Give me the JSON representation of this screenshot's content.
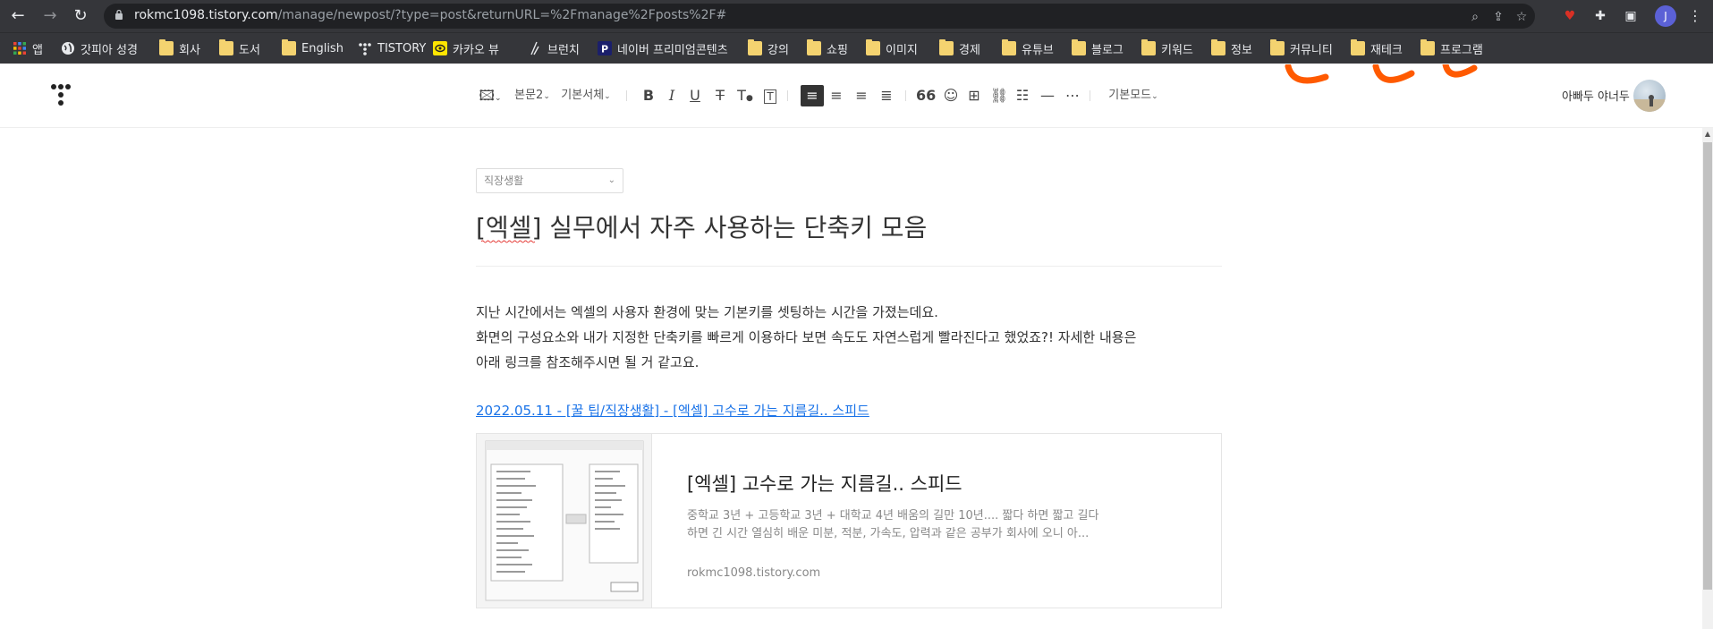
{
  "browser": {
    "url_host": "rokmc1098.tistory.com",
    "url_path": "/manage/newpost/?type=post&returnURL=%2Fmanage%2Fposts%2F#",
    "profile_initial": "J"
  },
  "bookmarks": [
    {
      "label": "앱",
      "icon": "apps-grid-icon"
    },
    {
      "label": "갓피아 성경",
      "icon": "globe-icon"
    },
    {
      "label": "회사",
      "icon": "folder-icon"
    },
    {
      "label": "도서",
      "icon": "folder-icon"
    },
    {
      "label": "English",
      "icon": "folder-icon"
    },
    {
      "label": "TISTORY",
      "icon": "tistory-icon"
    },
    {
      "label": "카카오 뷰",
      "icon": "kakao-view-icon"
    },
    {
      "label": "브런치",
      "icon": "brunch-icon"
    },
    {
      "label": "네이버 프리미엄콘텐츠",
      "icon": "naver-premium-icon"
    },
    {
      "label": "강의",
      "icon": "folder-icon"
    },
    {
      "label": "쇼핑",
      "icon": "folder-icon"
    },
    {
      "label": "이미지",
      "icon": "folder-icon"
    },
    {
      "label": "경제",
      "icon": "folder-icon"
    },
    {
      "label": "유튜브",
      "icon": "folder-icon"
    },
    {
      "label": "블로그",
      "icon": "folder-icon"
    },
    {
      "label": "키워드",
      "icon": "folder-icon"
    },
    {
      "label": "정보",
      "icon": "folder-icon"
    },
    {
      "label": "커뮤니티",
      "icon": "folder-icon"
    },
    {
      "label": "재테크",
      "icon": "folder-icon"
    },
    {
      "label": "프로그램",
      "icon": "folder-icon"
    }
  ],
  "toolbar": {
    "paragraph_style": "본문2",
    "font": "기본서체",
    "mode": "기본모드"
  },
  "user": {
    "name": "아빠두 야너두"
  },
  "post": {
    "category": "직장생활",
    "title": "[엑셀] 실무에서 자주 사용하는 단축키 모음",
    "para1": " 지난 시간에서는 엑셀의 사용자 환경에 맞는 기본키를 셋팅하는 시간을 가졌는데요.",
    "para2": "화면의 구성요소와 내가 지정한 단축키를 빠르게 이용하다 보면 속도도 자연스럽게 빨라진다고 했었죠?! 자세한 내용은",
    "para3": "아래 링크를 참조해주시면 될 거 같고요.",
    "link": "2022.05.11 - [꿀 팁/직장생활] - [엑셀] 고수로 가는 지름길.. 스피드"
  },
  "og_card": {
    "title": "[엑셀] 고수로 가는 지름길.. 스피드",
    "desc1": " 중학교 3년 + 고등학교 3년 + 대학교 4년 배움의 길만 10년.... 짧다 하면 짧고 길다",
    "desc2": "하면 긴 시간 열심히 배운 미분, 적분, 가속도, 압력과 같은 공부가 회사에 오니 아...",
    "url": "rokmc1098.tistory.com"
  },
  "colors": {
    "chrome_bg": "#35363a",
    "link": "#1a73e8",
    "annotation_orange": "#ff5a00"
  }
}
